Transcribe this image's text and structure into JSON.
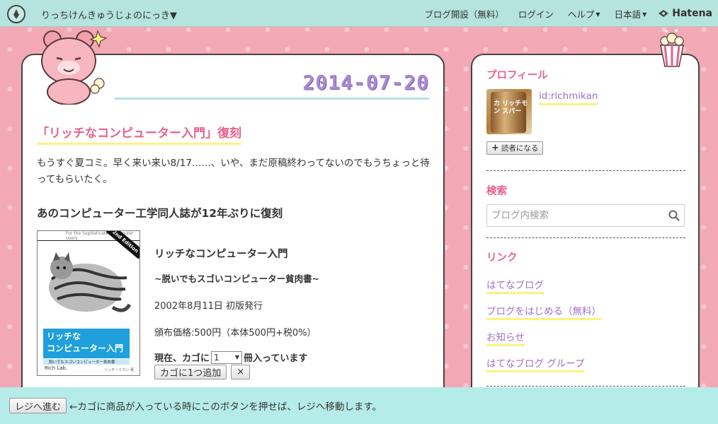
{
  "topbar": {
    "blog_name": "りっちけんきゅうじょのにっき",
    "links": [
      "ブログ開設（無料）",
      "ログイン",
      "ヘルプ",
      "日本語"
    ],
    "brand": "Hatena"
  },
  "entry": {
    "date": "2014-07-20",
    "title": "「リッチなコンピューター入門」復刻",
    "paragraph": "もうすぐ夏コミ。早く来い来い8/17……、いや、まだ原稿終わってないのでもうちょっと待ってもらいたく。",
    "heading": "あのコンピューター工学同人誌が12年ぶりに復刻",
    "book": {
      "cover_tagline": "For the Sophisticated Computer Users",
      "cover_badge": "2nd Edition",
      "cover_title_line1": "リッチな",
      "cover_title_line2": "コンピューター入門",
      "cover_subtitle": "脱いでもスゴいコンピューター貧肉書",
      "cover_publisher": "Rich Lab.",
      "cover_author": "リッチーミカン 著",
      "name": "リッチなコンピューター入門",
      "subtitle": "~脱いでもスゴいコンピューター貧肉書~",
      "release": "2002年8月11日 初版発行",
      "price": "頒布価格:500円（本体500円+税0%）",
      "cart_prefix": "現在、カゴに",
      "qty": "1",
      "cart_suffix": "冊入っています",
      "add_button": "カゴに1つ追加",
      "remove_button": "×"
    }
  },
  "sidebar": {
    "profile_heading": "プロフィール",
    "avatar_label": "カ リッチモン スパー",
    "user_id": "id:richmikan",
    "reader_button": "読者になる",
    "search_heading": "検索",
    "search_placeholder": "ブログ内検索",
    "links_heading": "リンク",
    "links": [
      "はてなブログ",
      "ブログをはじめる（無料）",
      "お知らせ",
      "はてなブログ グループ"
    ]
  },
  "cartbar": {
    "checkout_button": "レジへ進む",
    "message": "←カゴに商品が入っている時にこのボタンを押せば、レジへ移動します。"
  },
  "colors": {
    "background_pink": "#f3a8b5",
    "topbar_mint": "#b5e3dd",
    "heading_pink": "#e4628f",
    "link_purple": "#a070c8",
    "date_purple": "#a98ad4",
    "underline_yellow": "#fdf27d"
  },
  "icons": [
    "hatena-logo-icon",
    "caret-down-icon",
    "hatena-mark-icon",
    "search-icon",
    "plus-icon",
    "bear-mascot",
    "popcorn-mascot"
  ]
}
